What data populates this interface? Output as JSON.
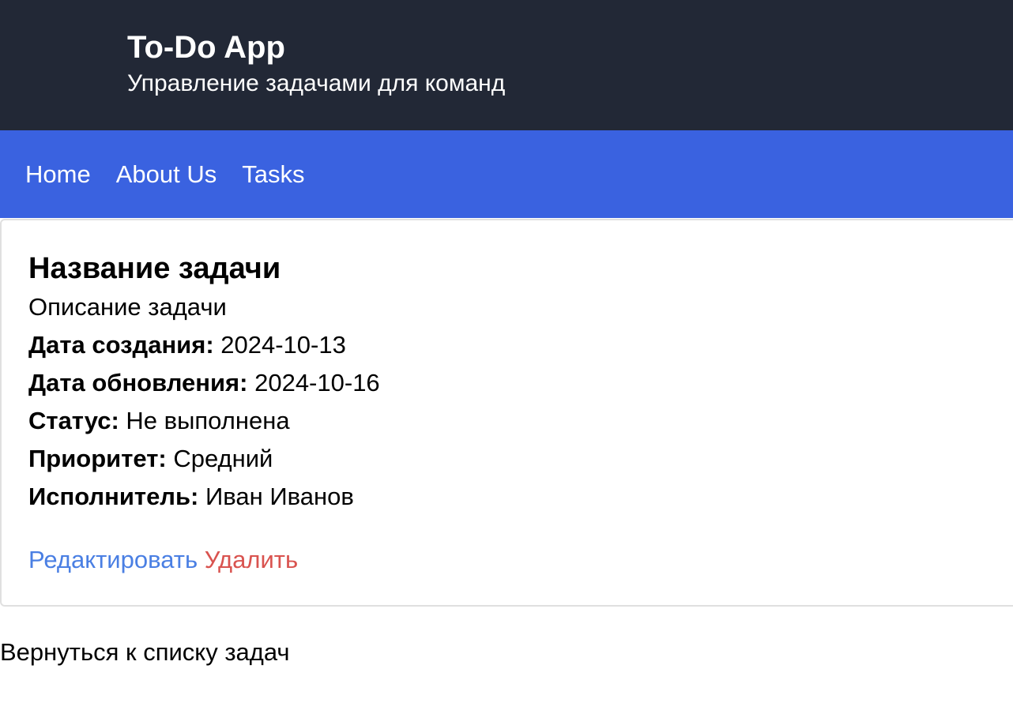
{
  "header": {
    "title": "To-Do App",
    "subtitle": "Управление задачами для команд"
  },
  "nav": {
    "items": [
      {
        "label": "Home"
      },
      {
        "label": "About Us"
      },
      {
        "label": "Tasks"
      }
    ]
  },
  "task": {
    "title": "Название задачи",
    "description": "Описание задачи",
    "fields": [
      {
        "label": "Дата создания:",
        "value": " 2024-10-13"
      },
      {
        "label": "Дата обновления:",
        "value": " 2024-10-16"
      },
      {
        "label": "Статус:",
        "value": " Не выполнена"
      },
      {
        "label": "Приоритет:",
        "value": " Средний"
      },
      {
        "label": "Исполнитель:",
        "value": " Иван Иванов"
      }
    ],
    "actions": {
      "edit_label": "Редактировать",
      "delete_label": "Удалить"
    }
  },
  "back_link": "Вернуться к списку задач",
  "colors": {
    "header_bg": "#222836",
    "nav_bg": "#3a62e0",
    "edit_link": "#4a7fe3",
    "delete_link": "#d9534f"
  }
}
